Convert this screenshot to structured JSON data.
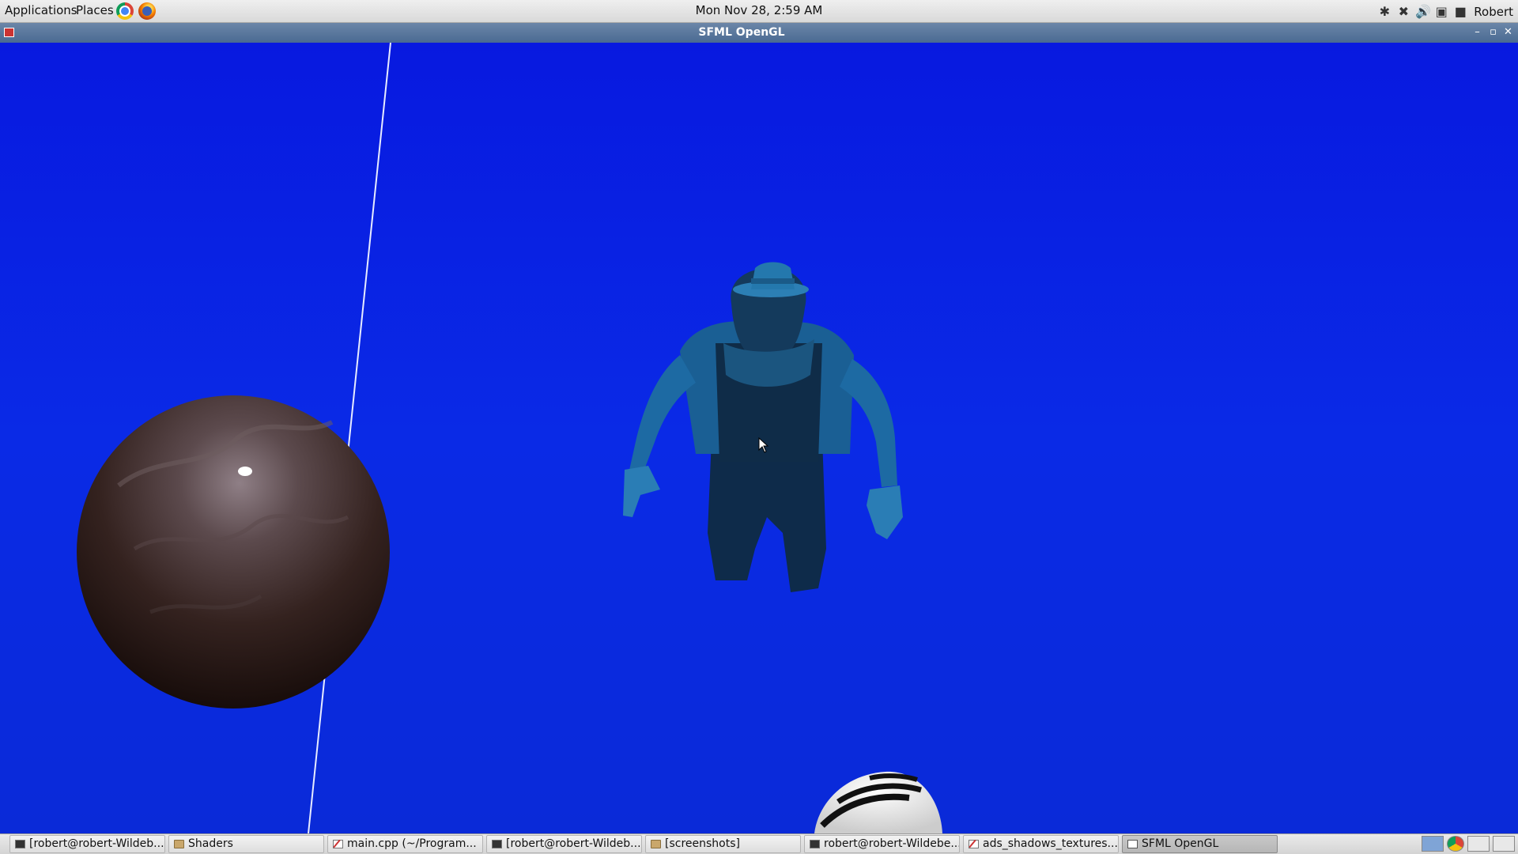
{
  "top_panel": {
    "applications_label": "Applications",
    "places_label": "Places",
    "launchers": [
      "chrome-icon",
      "firefox-icon"
    ],
    "clock": "Mon Nov 28,  2:59 AM",
    "tray_icons": [
      "bluetooth-icon",
      "network-disconnected-icon",
      "volume-icon",
      "display-icon",
      "chat-icon"
    ],
    "user_name": "Robert"
  },
  "window": {
    "title": "SFML OpenGL",
    "controls": [
      "minimize-icon",
      "maximize-icon",
      "close-icon"
    ]
  },
  "scene": {
    "background_color": "#0a22d8",
    "objects": [
      "textured-sphere",
      "character-model",
      "striped-object",
      "white-line"
    ]
  },
  "taskbar": {
    "tasks": [
      {
        "label": "[robert@robert-Wildeb...",
        "icon": "terminal-icon"
      },
      {
        "label": "Shaders",
        "icon": "folder-icon"
      },
      {
        "label": "main.cpp (~/Program...",
        "icon": "text-editor-icon"
      },
      {
        "label": "[robert@robert-Wildeb...",
        "icon": "terminal-icon"
      },
      {
        "label": "[screenshots]",
        "icon": "folder-icon"
      },
      {
        "label": "robert@robert-Wildebe...",
        "icon": "terminal-icon"
      },
      {
        "label": "ads_shadows_textures...",
        "icon": "text-editor-icon"
      },
      {
        "label": "SFML OpenGL",
        "icon": "window-icon",
        "active": true
      }
    ],
    "tray_icons": [
      "workspace-switcher-icon",
      "chrome-icon",
      "applet-icon",
      "show-desktop-icon"
    ]
  }
}
